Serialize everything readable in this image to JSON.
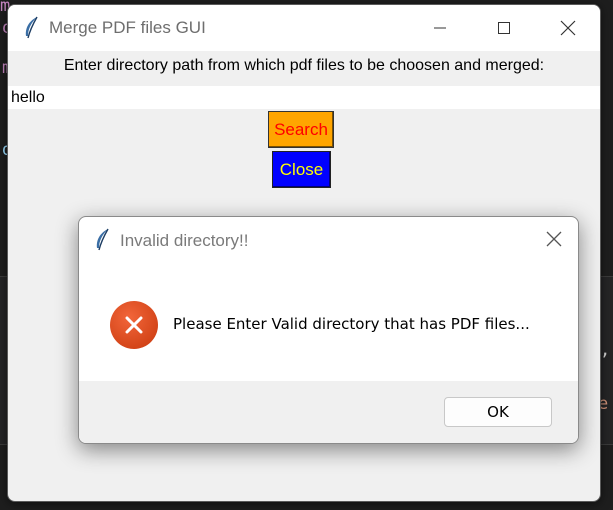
{
  "main_window": {
    "title": "Merge PDF files GUI",
    "prompt_label": "Enter directory path from which pdf files to be choosen and merged:",
    "path_value": "hello",
    "search_label": "Search",
    "close_label": "Close",
    "colors": {
      "search_bg": "#ffa500",
      "search_fg": "#ff0000",
      "close_bg": "#0000ff",
      "close_fg": "#ffff00"
    }
  },
  "dialog": {
    "title": "Invalid directory!!",
    "message": "Please Enter Valid directory that has PDF files...",
    "ok_label": "OK",
    "icon": "error-icon",
    "accent": "#e04a17"
  }
}
